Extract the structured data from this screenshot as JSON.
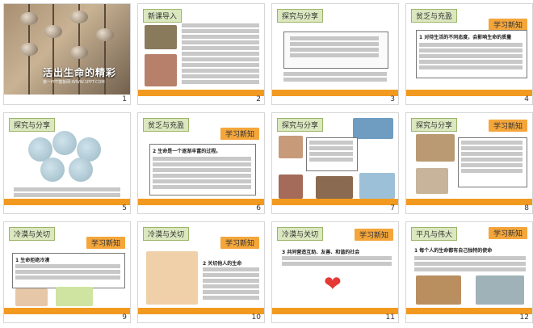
{
  "slides": [
    {
      "num": "1",
      "title": "活出生命的精彩",
      "subtitle": "第一PPT模板网-WWW.1PPT.COM"
    },
    {
      "num": "2",
      "badge": "新课导入"
    },
    {
      "num": "3",
      "badge": "探究与分享"
    },
    {
      "num": "4",
      "badge": "贫乏与充盈",
      "learn": "学习新知",
      "heading": "1 对待生活的不同态度，会影响生命的质量"
    },
    {
      "num": "5",
      "badge": "探究与分享"
    },
    {
      "num": "6",
      "badge": "贫乏与充盈",
      "learn": "学习新知",
      "heading": "2 生命是一个逐渐丰富的过程。"
    },
    {
      "num": "7",
      "badge": "探究与分享"
    },
    {
      "num": "8",
      "badge": "探究与分享",
      "learn": "学习新知"
    },
    {
      "num": "9",
      "badge": "冷漠与关切",
      "learn": "学习新知",
      "heading": "1 生命拒绝冷漠"
    },
    {
      "num": "10",
      "badge": "冷漠与关切",
      "learn": "学习新知",
      "heading": "2 关切他人的生命"
    },
    {
      "num": "11",
      "badge": "冷漠与关切",
      "learn": "学习新知",
      "heading": "3 共同营造互助、友善、和谐的社会"
    },
    {
      "num": "12",
      "badge": "平凡与伟大",
      "learn": "学习新知",
      "heading": "1 每个人的生命都有自己独特的使命"
    }
  ]
}
